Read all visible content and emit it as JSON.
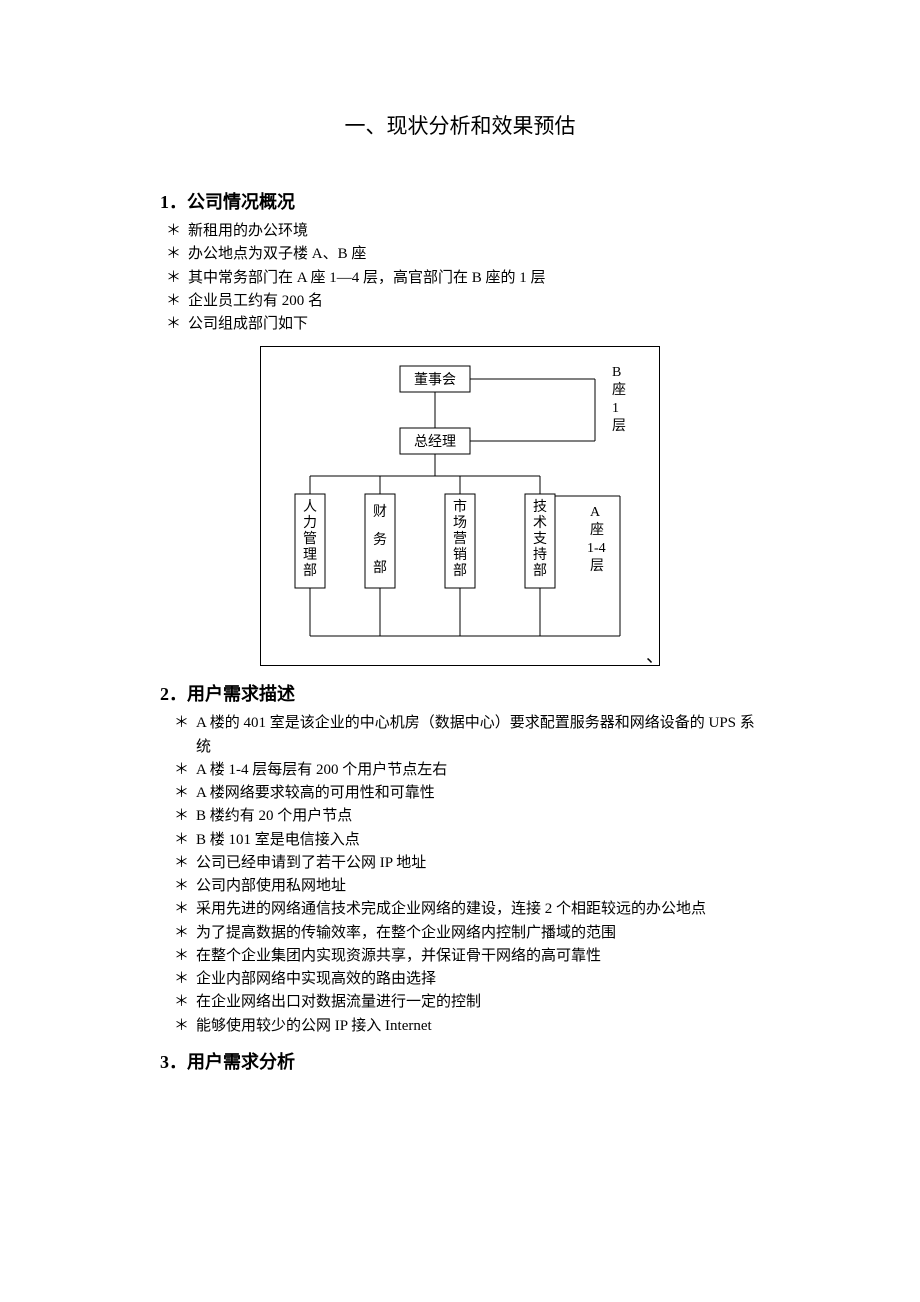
{
  "title": "一、现状分析和效果预估",
  "section1": {
    "num": "1",
    "heading": "．公司情况概况",
    "bullets": [
      "新租用的办公环境",
      "办公地点为双子楼 A、B 座",
      "其中常务部门在 A 座 1—4 层，高官部门在 B 座的 1 层",
      "企业员工约有 200 名",
      "公司组成部门如下"
    ]
  },
  "diagram": {
    "top": "董事会",
    "mid": "总经理",
    "depts": [
      "人力管理部",
      "财务部",
      "市场营销部",
      "技术支持部"
    ],
    "rightTop": "B座1层",
    "rightBottom": [
      "A",
      "座",
      "1-4",
      "层"
    ]
  },
  "section2": {
    "num": "2",
    "heading": "．用户需求描述",
    "bullets": [
      "A 楼的 401 室是该企业的中心机房（数据中心）要求配置服务器和网络设备的 UPS 系统",
      "A 楼 1-4 层每层有 200 个用户节点左右",
      "A 楼网络要求较高的可用性和可靠性",
      "B 楼约有 20 个用户节点",
      "B 楼 101 室是电信接入点",
      "公司已经申请到了若干公网 IP 地址",
      "公司内部使用私网地址",
      "采用先进的网络通信技术完成企业网络的建设，连接 2 个相距较远的办公地点",
      "为了提高数据的传输效率，在整个企业网络内控制广播域的范围",
      "在整个企业集团内实现资源共享，并保证骨干网络的高可靠性",
      "企业内部网络中实现高效的路由选择",
      "在企业网络出口对数据流量进行一定的控制",
      "能够使用较少的公网 IP 接入 Internet"
    ]
  },
  "section3": {
    "num": "3",
    "heading": "．用户需求分析"
  },
  "tick": "、"
}
